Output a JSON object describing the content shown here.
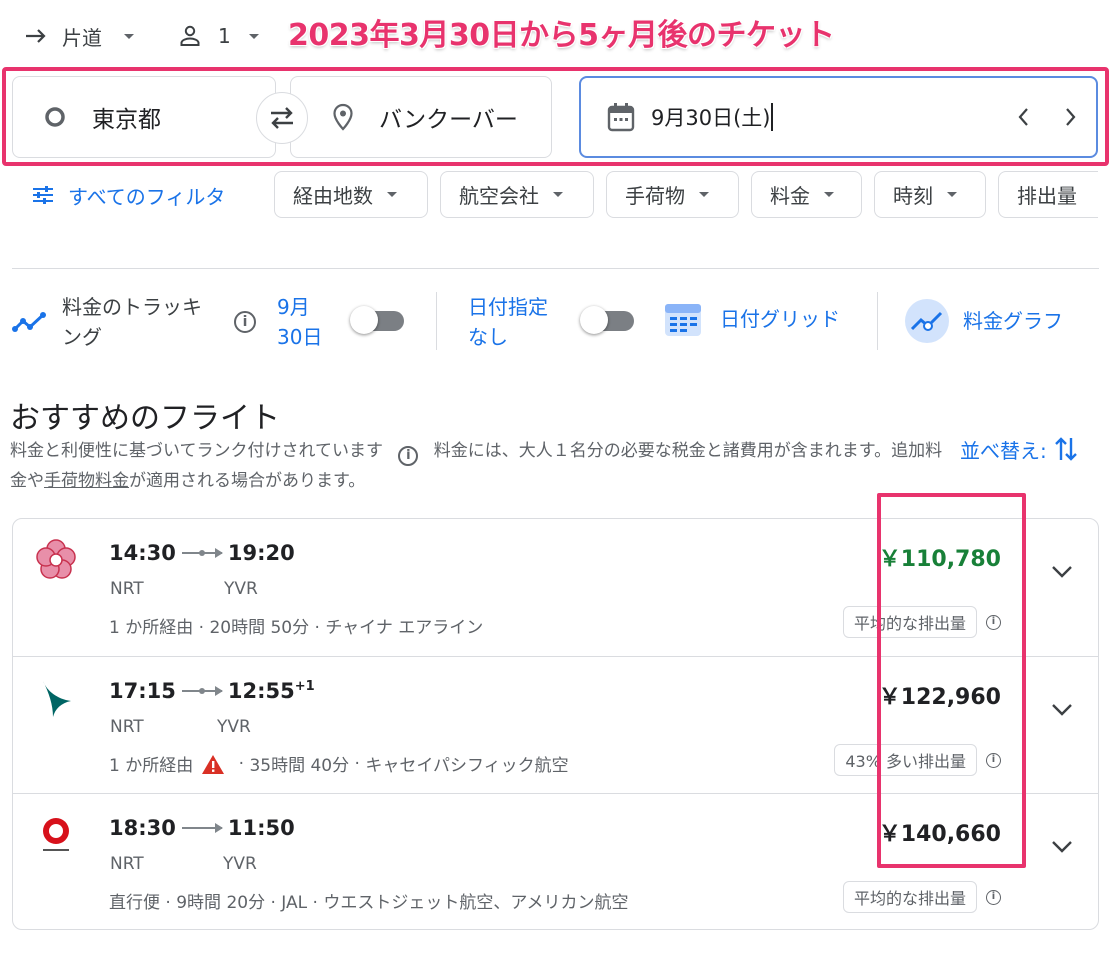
{
  "top": {
    "trip_type": "片道",
    "passengers": "1",
    "annotation": "2023年3月30日から5ヶ月後のチケット"
  },
  "search": {
    "origin": "東京都",
    "destination": "バンクーバー",
    "date": "9月30日(土)"
  },
  "filters": {
    "all_filters": "すべてのフィルタ",
    "chips": [
      "経由地数",
      "航空会社",
      "手荷物",
      "料金",
      "時刻",
      "排出量"
    ]
  },
  "tools": {
    "tracking_label": "料金のトラッキング",
    "tracking_date": "9月30日",
    "tracking_on": false,
    "any_dates_label": "日付指定なし",
    "any_dates_on": false,
    "date_grid": "日付グリッド",
    "price_graph": "料金グラフ"
  },
  "results": {
    "title": "おすすめのフライト",
    "desc_part1": "料金と利便性に基づいてランク付けされています",
    "desc_part2": "料金には、大人１名分の必要な税金と諸費用が含まれます。追加料金や",
    "desc_link": "手荷物料金",
    "desc_part3": "が適用される場合があります。",
    "sort_label": "並べ替え:"
  },
  "flights": [
    {
      "depart": "14:30",
      "arrive": "19:20",
      "plus": "",
      "from": "NRT",
      "to": "YVR",
      "stops": "1 か所経由",
      "warning": false,
      "duration": "20時間 50分",
      "airline": "チャイナ エアライン",
      "price": "￥110,780",
      "price_color": "#188038",
      "emissions": "平均的な排出量"
    },
    {
      "depart": "17:15",
      "arrive": "12:55",
      "plus": "+1",
      "from": "NRT",
      "to": "YVR",
      "stops": "1 か所経由",
      "warning": true,
      "duration": "35時間 40分",
      "airline": "キャセイパシフィック航空",
      "price": "￥122,960",
      "price_color": "#202124",
      "emissions": "43% 多い排出量"
    },
    {
      "depart": "18:30",
      "arrive": "11:50",
      "plus": "",
      "from": "NRT",
      "to": "YVR",
      "stops": "直行便",
      "warning": false,
      "duration": "9時間 20分",
      "airline": "JAL · ウエストジェット航空、アメリカン航空",
      "price": "￥140,660",
      "price_color": "#202124",
      "emissions": "平均的な排出量"
    }
  ]
}
